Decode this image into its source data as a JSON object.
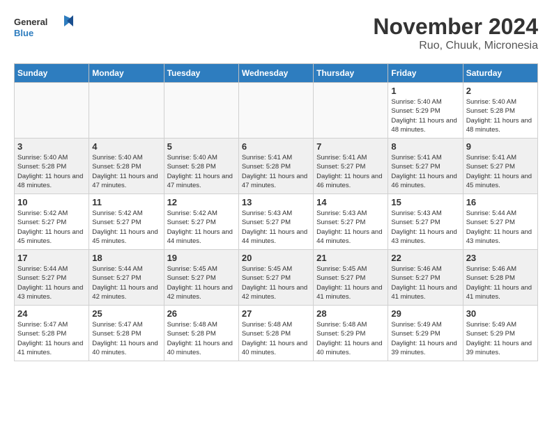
{
  "header": {
    "logo_line1": "General",
    "logo_line2": "Blue",
    "month": "November 2024",
    "location": "Ruo, Chuuk, Micronesia"
  },
  "weekdays": [
    "Sunday",
    "Monday",
    "Tuesday",
    "Wednesday",
    "Thursday",
    "Friday",
    "Saturday"
  ],
  "weeks": [
    [
      {
        "day": "",
        "info": ""
      },
      {
        "day": "",
        "info": ""
      },
      {
        "day": "",
        "info": ""
      },
      {
        "day": "",
        "info": ""
      },
      {
        "day": "",
        "info": ""
      },
      {
        "day": "1",
        "info": "Sunrise: 5:40 AM\nSunset: 5:29 PM\nDaylight: 11 hours and 48 minutes."
      },
      {
        "day": "2",
        "info": "Sunrise: 5:40 AM\nSunset: 5:28 PM\nDaylight: 11 hours and 48 minutes."
      }
    ],
    [
      {
        "day": "3",
        "info": "Sunrise: 5:40 AM\nSunset: 5:28 PM\nDaylight: 11 hours and 48 minutes."
      },
      {
        "day": "4",
        "info": "Sunrise: 5:40 AM\nSunset: 5:28 PM\nDaylight: 11 hours and 47 minutes."
      },
      {
        "day": "5",
        "info": "Sunrise: 5:40 AM\nSunset: 5:28 PM\nDaylight: 11 hours and 47 minutes."
      },
      {
        "day": "6",
        "info": "Sunrise: 5:41 AM\nSunset: 5:28 PM\nDaylight: 11 hours and 47 minutes."
      },
      {
        "day": "7",
        "info": "Sunrise: 5:41 AM\nSunset: 5:27 PM\nDaylight: 11 hours and 46 minutes."
      },
      {
        "day": "8",
        "info": "Sunrise: 5:41 AM\nSunset: 5:27 PM\nDaylight: 11 hours and 46 minutes."
      },
      {
        "day": "9",
        "info": "Sunrise: 5:41 AM\nSunset: 5:27 PM\nDaylight: 11 hours and 45 minutes."
      }
    ],
    [
      {
        "day": "10",
        "info": "Sunrise: 5:42 AM\nSunset: 5:27 PM\nDaylight: 11 hours and 45 minutes."
      },
      {
        "day": "11",
        "info": "Sunrise: 5:42 AM\nSunset: 5:27 PM\nDaylight: 11 hours and 45 minutes."
      },
      {
        "day": "12",
        "info": "Sunrise: 5:42 AM\nSunset: 5:27 PM\nDaylight: 11 hours and 44 minutes."
      },
      {
        "day": "13",
        "info": "Sunrise: 5:43 AM\nSunset: 5:27 PM\nDaylight: 11 hours and 44 minutes."
      },
      {
        "day": "14",
        "info": "Sunrise: 5:43 AM\nSunset: 5:27 PM\nDaylight: 11 hours and 44 minutes."
      },
      {
        "day": "15",
        "info": "Sunrise: 5:43 AM\nSunset: 5:27 PM\nDaylight: 11 hours and 43 minutes."
      },
      {
        "day": "16",
        "info": "Sunrise: 5:44 AM\nSunset: 5:27 PM\nDaylight: 11 hours and 43 minutes."
      }
    ],
    [
      {
        "day": "17",
        "info": "Sunrise: 5:44 AM\nSunset: 5:27 PM\nDaylight: 11 hours and 43 minutes."
      },
      {
        "day": "18",
        "info": "Sunrise: 5:44 AM\nSunset: 5:27 PM\nDaylight: 11 hours and 42 minutes."
      },
      {
        "day": "19",
        "info": "Sunrise: 5:45 AM\nSunset: 5:27 PM\nDaylight: 11 hours and 42 minutes."
      },
      {
        "day": "20",
        "info": "Sunrise: 5:45 AM\nSunset: 5:27 PM\nDaylight: 11 hours and 42 minutes."
      },
      {
        "day": "21",
        "info": "Sunrise: 5:45 AM\nSunset: 5:27 PM\nDaylight: 11 hours and 41 minutes."
      },
      {
        "day": "22",
        "info": "Sunrise: 5:46 AM\nSunset: 5:27 PM\nDaylight: 11 hours and 41 minutes."
      },
      {
        "day": "23",
        "info": "Sunrise: 5:46 AM\nSunset: 5:28 PM\nDaylight: 11 hours and 41 minutes."
      }
    ],
    [
      {
        "day": "24",
        "info": "Sunrise: 5:47 AM\nSunset: 5:28 PM\nDaylight: 11 hours and 41 minutes."
      },
      {
        "day": "25",
        "info": "Sunrise: 5:47 AM\nSunset: 5:28 PM\nDaylight: 11 hours and 40 minutes."
      },
      {
        "day": "26",
        "info": "Sunrise: 5:48 AM\nSunset: 5:28 PM\nDaylight: 11 hours and 40 minutes."
      },
      {
        "day": "27",
        "info": "Sunrise: 5:48 AM\nSunset: 5:28 PM\nDaylight: 11 hours and 40 minutes."
      },
      {
        "day": "28",
        "info": "Sunrise: 5:48 AM\nSunset: 5:29 PM\nDaylight: 11 hours and 40 minutes."
      },
      {
        "day": "29",
        "info": "Sunrise: 5:49 AM\nSunset: 5:29 PM\nDaylight: 11 hours and 39 minutes."
      },
      {
        "day": "30",
        "info": "Sunrise: 5:49 AM\nSunset: 5:29 PM\nDaylight: 11 hours and 39 minutes."
      }
    ]
  ]
}
